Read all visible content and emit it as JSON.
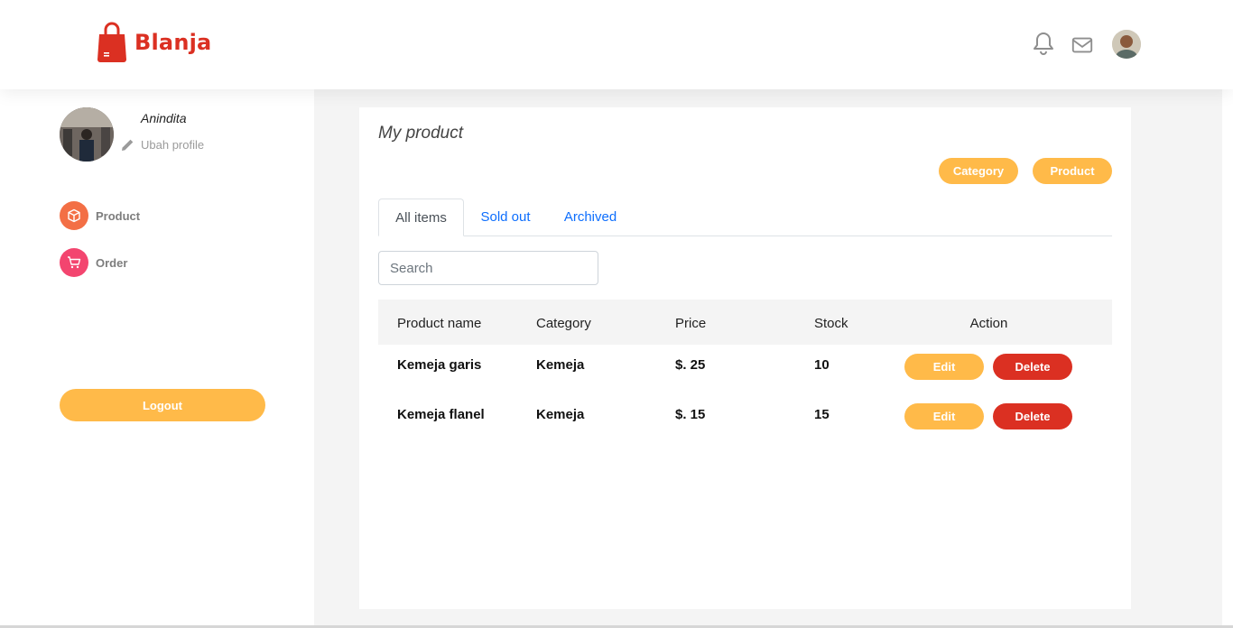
{
  "header": {
    "brand": "Blanja",
    "brand_color": "#DB3022",
    "icons": [
      "bag-logo-icon",
      "bell-icon",
      "mail-icon",
      "user-avatar"
    ]
  },
  "sidebar": {
    "profile_name": "Anindita",
    "edit_profile": "Ubah profile",
    "nav": [
      {
        "label": "Product",
        "icon": "box-icon",
        "color": "#F36F45"
      },
      {
        "label": "Order",
        "icon": "cart-icon",
        "color": "#F3456F"
      }
    ],
    "logout": "Logout"
  },
  "main": {
    "title": "My product",
    "buttons": {
      "category": "Category",
      "product": "Product"
    },
    "tabs": [
      {
        "label": "All items",
        "active": true
      },
      {
        "label": "Sold out",
        "active": false
      },
      {
        "label": "Archived",
        "active": false
      }
    ],
    "search_placeholder": "Search",
    "table": {
      "headers": [
        "Product name",
        "Category",
        "Price",
        "Stock",
        "Action"
      ],
      "rows": [
        {
          "name": "Kemeja garis",
          "category": "Kemeja",
          "price": "$. 25",
          "stock": "10"
        },
        {
          "name": "Kemeja flanel",
          "category": "Kemeja",
          "price": "$. 15",
          "stock": "15"
        }
      ],
      "edit_label": "Edit",
      "delete_label": "Delete"
    }
  },
  "colors": {
    "accent": "#FFBA49",
    "danger": "#DB3022",
    "background": "#F4F4F4"
  }
}
